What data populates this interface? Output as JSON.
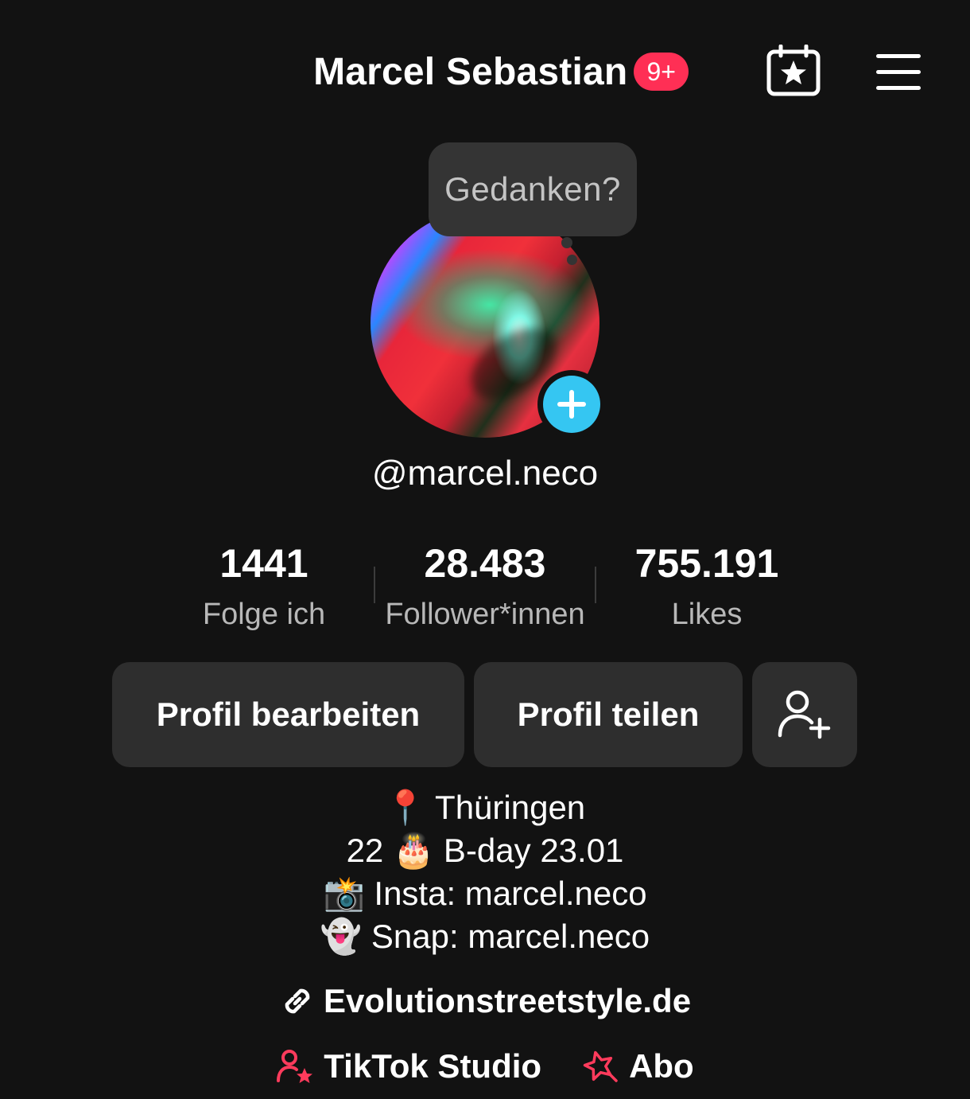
{
  "header": {
    "title": "Marcel Sebastian",
    "badge": "9+",
    "calendar_icon": "calendar-star-icon",
    "menu_icon": "hamburger-menu-icon"
  },
  "thought_bubble": {
    "placeholder": "Gedanken?"
  },
  "profile": {
    "username": "@marcel.neco",
    "add_story_icon": "plus-icon"
  },
  "stats": [
    {
      "value": "1441",
      "label": "Folge ich"
    },
    {
      "value": "28.483",
      "label": "Follower*innen"
    },
    {
      "value": "755.191",
      "label": "Likes"
    }
  ],
  "buttons": {
    "edit_profile": "Profil bearbeiten",
    "share_profile": "Profil teilen",
    "add_friend_icon": "add-friend-icon"
  },
  "bio": {
    "lines": [
      "📍 Thüringen",
      "22 🎂 B-day 23.01",
      "📸 Insta: marcel.neco",
      "👻 Snap: marcel.neco"
    ]
  },
  "link": {
    "text": "Evolutionstreetstyle.de",
    "icon": "link-icon"
  },
  "bottom": {
    "studio_label": "TikTok Studio",
    "studio_icon": "creator-star-icon",
    "abo_label": "Abo",
    "abo_icon": "subscription-star-icon"
  },
  "colors": {
    "background": "#121212",
    "badge": "#ff2f55",
    "button": "#2e2e2e",
    "add_story": "#35c6f2",
    "accent_pink": "#ff3b5c"
  }
}
